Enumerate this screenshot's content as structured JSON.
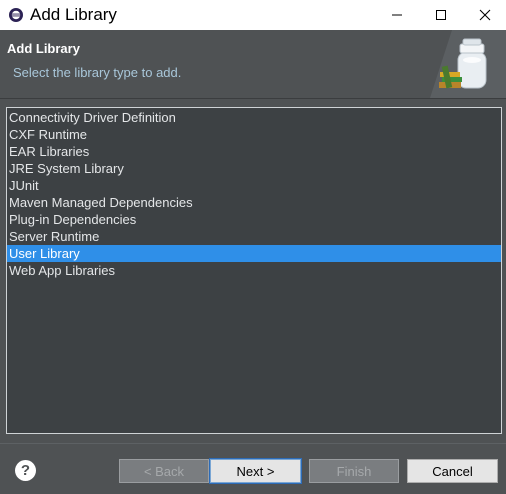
{
  "window": {
    "title": "Add Library",
    "controls": {
      "minimize_icon": "minimize-icon",
      "maximize_icon": "maximize-icon",
      "close_icon": "close-icon"
    }
  },
  "banner": {
    "title": "Add Library",
    "subtitle": "Select the library type to add.",
    "icon": "library-jar-icon"
  },
  "library_types": {
    "items": [
      "Connectivity Driver Definition",
      "CXF Runtime",
      "EAR Libraries",
      "JRE System Library",
      "JUnit",
      "Maven Managed Dependencies",
      "Plug-in Dependencies",
      "Server Runtime",
      "User Library",
      "Web App Libraries"
    ],
    "selected": "User Library"
  },
  "footer": {
    "help_label": "?",
    "back_label": "< Back",
    "next_label": "Next >",
    "finish_label": "Finish",
    "cancel_label": "Cancel"
  },
  "colors": {
    "background": "#4f5254",
    "list_background": "#3d4144",
    "selection": "#2f8fe8",
    "subtitle": "#a9c7da"
  }
}
